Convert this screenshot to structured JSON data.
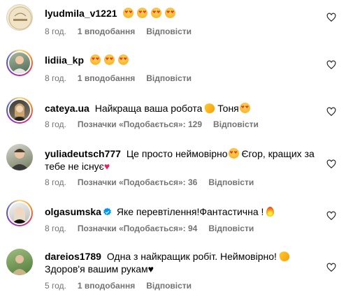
{
  "comments": [
    {
      "username": "lyudmila_v1221",
      "text": "",
      "emoji_after": 4,
      "time": "8 год.",
      "likes": "1 вподобання",
      "reply": "Відповісти"
    },
    {
      "username": "lidiia_kp",
      "text": "",
      "emoji_after": 3,
      "time": "8 год.",
      "likes": "1 вподобання",
      "reply": "Відповісти"
    },
    {
      "username": "cateya.ua",
      "text": "Найкраща ваша робота",
      "text2": "Тоня",
      "time": "8 год.",
      "likes": "Позначки «Подобається»: 129",
      "reply": "Відповісти"
    },
    {
      "username": "yuliadeutsch777",
      "text": "Це просто неймовірно",
      "text2": "Єгор, кращих за тебе не існує",
      "time": "8 год.",
      "likes": "Позначки «Подобається»: 36",
      "reply": "Відповісти"
    },
    {
      "username": "olgasumska",
      "text": "Яке перевтілення!Фантастична !",
      "time": "8 год.",
      "likes": "Позначки «Подобається»: 94",
      "reply": "Відповісти"
    },
    {
      "username": "dareios1789",
      "text": "Одна з найкращик робіт. Неймовірно!",
      "text2": "Здоров'я вашим рукам",
      "time": "5 год.",
      "likes": "1 вподобання",
      "reply": "Відповісти"
    }
  ],
  "icons": {
    "like": "heart-outline-icon",
    "verified": "verified-badge-icon",
    "emoji_face": "heart-eyes-emoji",
    "emoji_clap": "clapping-hands-emoji",
    "emoji_fire": "fire-emoji"
  },
  "colors": {
    "meta": "#737373",
    "verified": "#0095f6"
  }
}
